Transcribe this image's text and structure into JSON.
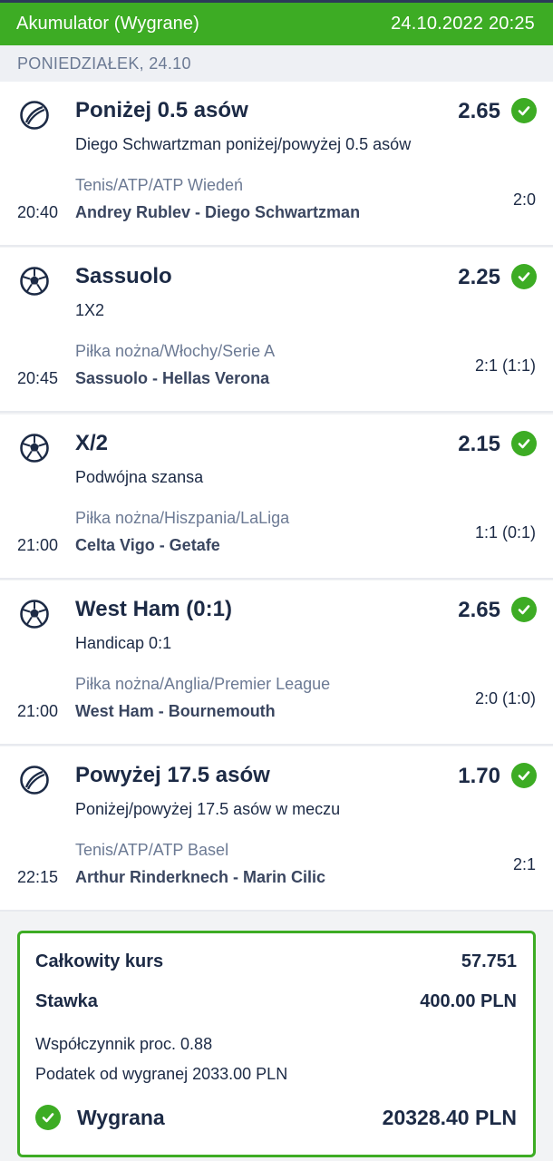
{
  "header": {
    "title": "Akumulator (Wygrane)",
    "datetime": "24.10.2022 20:25"
  },
  "day": "PONIEDZIAŁEK, 24.10",
  "bets": [
    {
      "sport_icon": "tennis-ball-icon",
      "pick": "Poniżej 0.5 asów",
      "odds": "2.65",
      "market": "Diego Schwartzman poniżej/powyżej 0.5 asów",
      "league": "Tenis/ATP/ATP Wiedeń",
      "time": "20:40",
      "teams": "Andrey Rublev - Diego Schwartzman",
      "score": "2:0"
    },
    {
      "sport_icon": "soccer-ball-icon",
      "pick": "Sassuolo",
      "odds": "2.25",
      "market": "1X2",
      "league": "Piłka nożna/Włochy/Serie A",
      "time": "20:45",
      "teams": "Sassuolo - Hellas Verona",
      "score": "2:1 (1:1)"
    },
    {
      "sport_icon": "soccer-ball-icon",
      "pick": "X/2",
      "odds": "2.15",
      "market": "Podwójna szansa",
      "league": "Piłka nożna/Hiszpania/LaLiga",
      "time": "21:00",
      "teams": "Celta Vigo - Getafe",
      "score": "1:1 (0:1)"
    },
    {
      "sport_icon": "soccer-ball-icon",
      "pick": "West Ham (0:1)",
      "odds": "2.65",
      "market": "Handicap 0:1",
      "league": "Piłka nożna/Anglia/Premier League",
      "time": "21:00",
      "teams": "West Ham - Bournemouth",
      "score": "2:0 (1:0)"
    },
    {
      "sport_icon": "tennis-ball-icon",
      "pick": "Powyżej 17.5 asów",
      "odds": "1.70",
      "market": "Poniżej/powyżej 17.5 asów w meczu",
      "league": "Tenis/ATP/ATP Basel",
      "time": "22:15",
      "teams": "Arthur Rinderknech - Marin Cilic",
      "score": "2:1"
    }
  ],
  "summary": {
    "total_odds_label": "Całkowity kurs",
    "total_odds": "57.751",
    "stake_label": "Stawka",
    "stake": "400.00 PLN",
    "coefficient": "Współczynnik proc. 0.88",
    "tax": "Podatek od wygranej 2033.00 PLN",
    "win_label": "Wygrana",
    "win_amount": "20328.40 PLN"
  },
  "colors": {
    "accent_green": "#3dac24",
    "text_dark": "#1c2a45",
    "text_muted": "#6c7a94"
  }
}
